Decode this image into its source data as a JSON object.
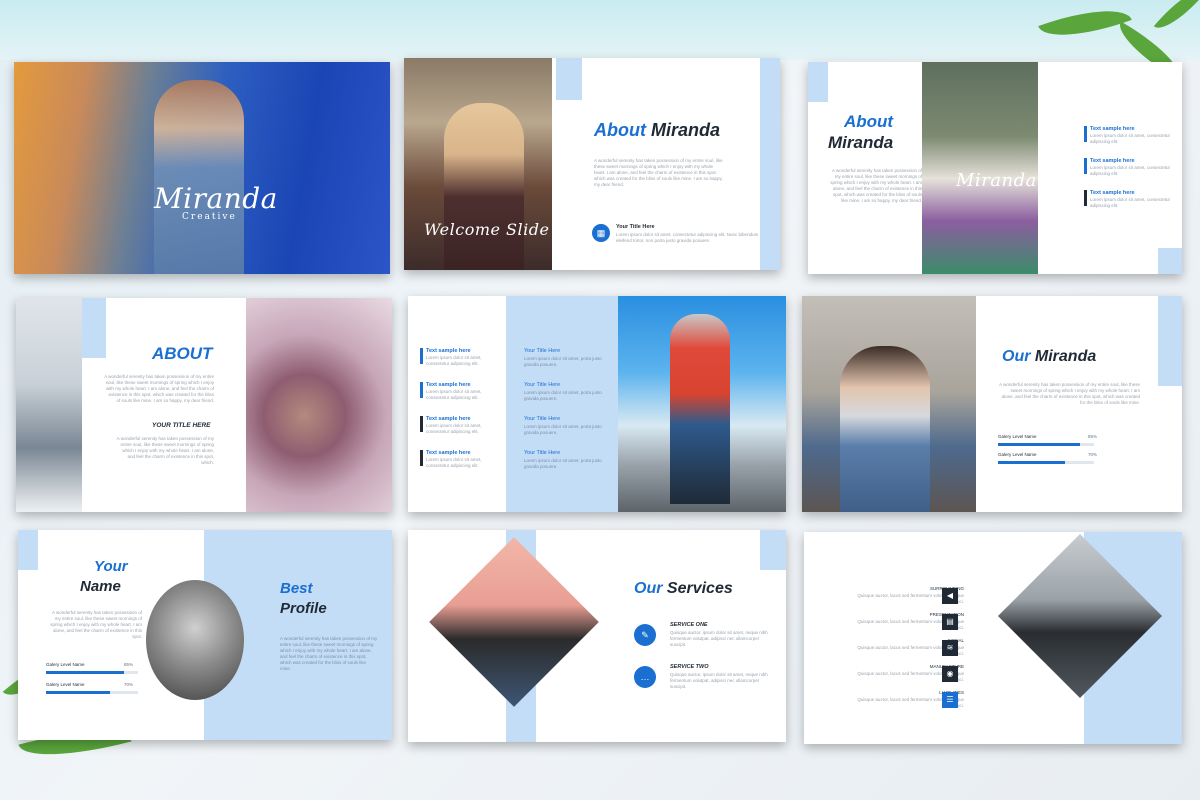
{
  "slide1": {
    "script_title": "Miranda",
    "script_sub": "Creative"
  },
  "slide2": {
    "script": "Welcome Slide",
    "title_blue": "About",
    "title_dark": "Miranda",
    "body": "A wonderful serenity has taken possession of my entire soul, like these sweet mornings of spring which I enjoy with my whole heart. I am alone, and feel the charm of existence in this spot, which was created for the bliss of souls like mine. I am so happy, my dear friend.",
    "item_title": "Your Title Here",
    "item_body": "Lorem ipsum dolor sit amet, consectetur adipiscing elit. Nunc bibendum eleifend tortor, non porta justo gravida posuere."
  },
  "slide3": {
    "title_blue": "About",
    "title_dark": "Miranda",
    "script": "Miranda",
    "body": "A wonderful serenity has taken possession of my entire soul, like these sweet mornings of spring which I enjoy with my whole heart. I am alone, and feel the charm of existence in this spot, which was created for the bliss of souls like mine. I am so happy, my dear friend.",
    "items": [
      {
        "title": "Text sample here",
        "body": "Lorem ipsum dolor sit amet, consectetur adipiscing elit."
      },
      {
        "title": "Text sample here",
        "body": "Lorem ipsum dolor sit amet, consectetur adipiscing elit."
      },
      {
        "title": "Text sample here",
        "body": "Lorem ipsum dolor sit amet, consectetur adipiscing elit."
      }
    ]
  },
  "slide4": {
    "title": "ABOUT",
    "body": "A wonderful serenity has taken possession of my entire soul, like these sweet mornings of spring which I enjoy with my whole heart. I am alone, and feel the charm of existence in this spot, which was created for the bliss of souls like mine. I am so happy, my dear friend.",
    "subtitle": "YOUR TITLE HERE",
    "body2": "A wonderful serenity has taken possession of my entire soul, like these sweet mornings of spring which I enjoy with my whole heart. I am alone, and feel the charm of existence in this spot, which."
  },
  "slide5": {
    "left_items": [
      {
        "title": "Text sample here",
        "body": "Lorem ipsum dolor sit amet, consectetur adipiscing elit."
      },
      {
        "title": "Text sample here",
        "body": "Lorem ipsum dolor sit amet, consectetur adipiscing elit."
      },
      {
        "title": "Text sample here",
        "body": "Lorem ipsum dolor sit amet, consectetur adipiscing elit."
      },
      {
        "title": "Text sample here",
        "body": "Lorem ipsum dolor sit amet, consectetur adipiscing elit."
      }
    ],
    "mid_items": [
      {
        "title": "Your Title Here",
        "body": "Lorem ipsum dolor sit amet, porta justo gravida posuere."
      },
      {
        "title": "Your Title Here",
        "body": "Lorem ipsum dolor sit amet, porta justo gravida posuere."
      },
      {
        "title": "Your Title Here",
        "body": "Lorem ipsum dolor sit amet, porta justo gravida posuere."
      },
      {
        "title": "Your Title Here",
        "body": "Lorem ipsum dolor sit amet, porta justo gravida posuere."
      }
    ]
  },
  "slide6": {
    "title_blue": "Our",
    "title_dark": "Miranda",
    "body": "A wonderful serenity has taken possession of my entire soul, like these sweet mornings of spring which I enjoy with my whole heart. I am alone, and feel the charm of existence in this spot, which was created for the bliss of souls like mine.",
    "bars": [
      {
        "label": "Galery Level Name",
        "pct_text": "85%",
        "value": 0.85
      },
      {
        "label": "Galery Level Name",
        "pct_text": "70%",
        "value": 0.7
      }
    ]
  },
  "slide7": {
    "your": "Your",
    "name": "Name",
    "best": "Best",
    "profile": "Profile",
    "body": "A wonderful serenity has taken possession of my entire soul, like these sweet mornings of spring which I enjoy with my whole heart. I am alone, and feel the charm of existence in this spot.",
    "body2": "A wonderful serenity has taken possession of my entire soul, like these sweet mornings of spring which I enjoy with my whole heart. I am alone, and feel the charm of existence in this spot, which was created for the bliss of souls like mine.",
    "bars": [
      {
        "label": "Galery Level Name",
        "pct_text": "85%",
        "value": 0.85
      },
      {
        "label": "Galery Level Name",
        "pct_text": "70%",
        "value": 0.7
      }
    ]
  },
  "slide8": {
    "title_blue": "Our",
    "title_dark": "Services",
    "services": [
      {
        "title": "SERVICE ONE",
        "body": "Quisque auctor, ipsum dolor sit amet, neque nibh fermentum volutpat, adipisci nec ullamcorper suscipit.",
        "icon": "edit-icon"
      },
      {
        "title": "SERVICE TWO",
        "body": "Quisque auctor, ipsum dolor sit amet, neque nibh fermentum volutpat, adipisci nec ullamcorper suscipit.",
        "icon": "chat-icon"
      }
    ]
  },
  "slide9": {
    "items": [
      {
        "title": "SURROUNDING",
        "body": "Quisque auctor, lacus sed fermentum volutpat, neque nibh mici.",
        "icon": "arrow-icon"
      },
      {
        "title": "PRESENTATION",
        "body": "Quisque auctor, lacus sed fermentum volutpat, neque nibh mici.",
        "icon": "briefcase-icon"
      },
      {
        "title": "SIGNAL",
        "body": "Quisque auctor, lacus sed fermentum volutpat, neque nibh mici.",
        "icon": "signal-icon"
      },
      {
        "title": "MANUFACTURE",
        "body": "Quisque auctor, lacus sed fermentum volutpat, neque nibh mici.",
        "icon": "bulb-icon"
      },
      {
        "title": "LIABILITIES",
        "body": "Quisque auctor, lacus sed fermentum volutpat, neque nibh mici.",
        "icon": "database-icon"
      }
    ]
  }
}
